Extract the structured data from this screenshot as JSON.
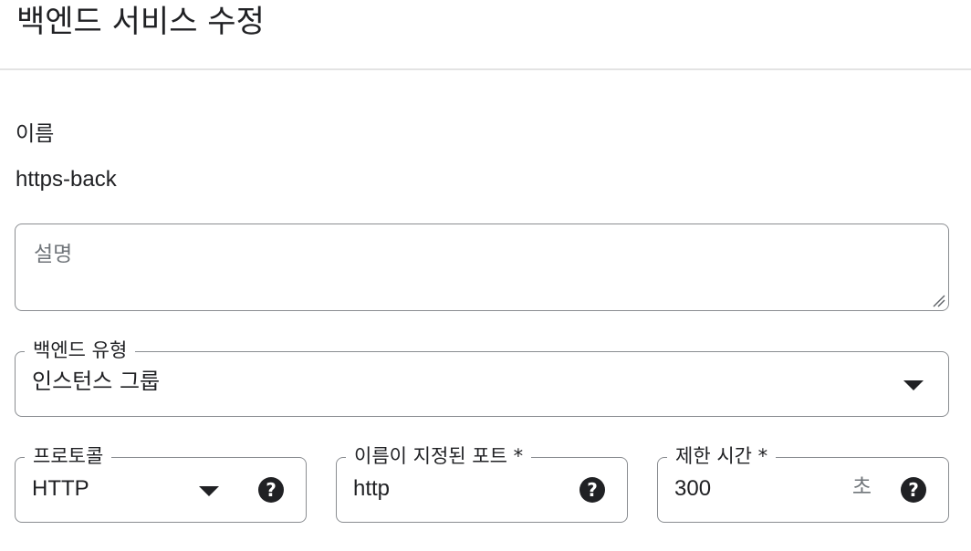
{
  "header": {
    "title": "백엔드 서비스 수정"
  },
  "name": {
    "label": "이름",
    "value": "https-back"
  },
  "description": {
    "placeholder": "설명",
    "value": ""
  },
  "backend_type": {
    "label": "백엔드 유형",
    "value": "인스턴스 그룹"
  },
  "protocol": {
    "label": "프로토콜",
    "value": "HTTP",
    "help_icon": "help-icon"
  },
  "named_port": {
    "label": "이름이 지정된 포트 *",
    "value": "http",
    "help_icon": "help-icon"
  },
  "timeout": {
    "label": "제한 시간 *",
    "value": "300",
    "unit": "초",
    "help_icon": "help-icon"
  },
  "icon_glyph": "?",
  "colors": {
    "text": "#202124",
    "border": "#8a8d91",
    "muted": "#70757a",
    "divider": "#e3e3e3"
  }
}
